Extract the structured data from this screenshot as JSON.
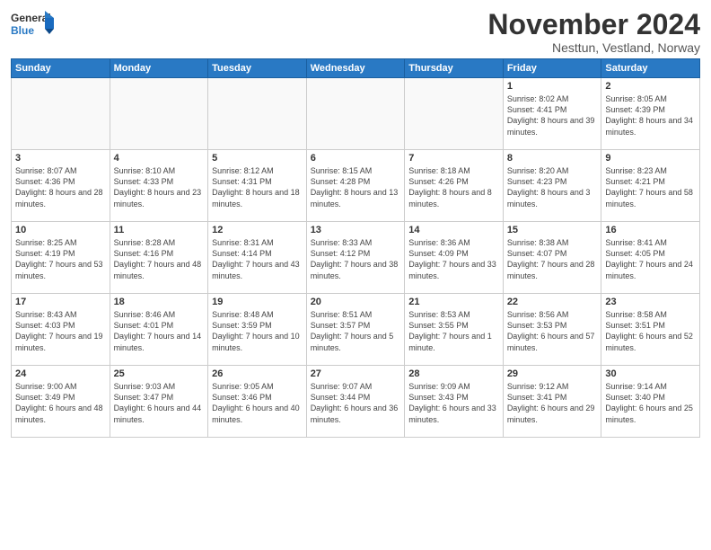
{
  "header": {
    "logo_general": "General",
    "logo_blue": "Blue",
    "month_title": "November 2024",
    "location": "Nesttun, Vestland, Norway"
  },
  "weekdays": [
    "Sunday",
    "Monday",
    "Tuesday",
    "Wednesday",
    "Thursday",
    "Friday",
    "Saturday"
  ],
  "weeks": [
    [
      {
        "day": "",
        "info": ""
      },
      {
        "day": "",
        "info": ""
      },
      {
        "day": "",
        "info": ""
      },
      {
        "day": "",
        "info": ""
      },
      {
        "day": "",
        "info": ""
      },
      {
        "day": "1",
        "info": "Sunrise: 8:02 AM\nSunset: 4:41 PM\nDaylight: 8 hours and 39 minutes."
      },
      {
        "day": "2",
        "info": "Sunrise: 8:05 AM\nSunset: 4:39 PM\nDaylight: 8 hours and 34 minutes."
      }
    ],
    [
      {
        "day": "3",
        "info": "Sunrise: 8:07 AM\nSunset: 4:36 PM\nDaylight: 8 hours and 28 minutes."
      },
      {
        "day": "4",
        "info": "Sunrise: 8:10 AM\nSunset: 4:33 PM\nDaylight: 8 hours and 23 minutes."
      },
      {
        "day": "5",
        "info": "Sunrise: 8:12 AM\nSunset: 4:31 PM\nDaylight: 8 hours and 18 minutes."
      },
      {
        "day": "6",
        "info": "Sunrise: 8:15 AM\nSunset: 4:28 PM\nDaylight: 8 hours and 13 minutes."
      },
      {
        "day": "7",
        "info": "Sunrise: 8:18 AM\nSunset: 4:26 PM\nDaylight: 8 hours and 8 minutes."
      },
      {
        "day": "8",
        "info": "Sunrise: 8:20 AM\nSunset: 4:23 PM\nDaylight: 8 hours and 3 minutes."
      },
      {
        "day": "9",
        "info": "Sunrise: 8:23 AM\nSunset: 4:21 PM\nDaylight: 7 hours and 58 minutes."
      }
    ],
    [
      {
        "day": "10",
        "info": "Sunrise: 8:25 AM\nSunset: 4:19 PM\nDaylight: 7 hours and 53 minutes."
      },
      {
        "day": "11",
        "info": "Sunrise: 8:28 AM\nSunset: 4:16 PM\nDaylight: 7 hours and 48 minutes."
      },
      {
        "day": "12",
        "info": "Sunrise: 8:31 AM\nSunset: 4:14 PM\nDaylight: 7 hours and 43 minutes."
      },
      {
        "day": "13",
        "info": "Sunrise: 8:33 AM\nSunset: 4:12 PM\nDaylight: 7 hours and 38 minutes."
      },
      {
        "day": "14",
        "info": "Sunrise: 8:36 AM\nSunset: 4:09 PM\nDaylight: 7 hours and 33 minutes."
      },
      {
        "day": "15",
        "info": "Sunrise: 8:38 AM\nSunset: 4:07 PM\nDaylight: 7 hours and 28 minutes."
      },
      {
        "day": "16",
        "info": "Sunrise: 8:41 AM\nSunset: 4:05 PM\nDaylight: 7 hours and 24 minutes."
      }
    ],
    [
      {
        "day": "17",
        "info": "Sunrise: 8:43 AM\nSunset: 4:03 PM\nDaylight: 7 hours and 19 minutes."
      },
      {
        "day": "18",
        "info": "Sunrise: 8:46 AM\nSunset: 4:01 PM\nDaylight: 7 hours and 14 minutes."
      },
      {
        "day": "19",
        "info": "Sunrise: 8:48 AM\nSunset: 3:59 PM\nDaylight: 7 hours and 10 minutes."
      },
      {
        "day": "20",
        "info": "Sunrise: 8:51 AM\nSunset: 3:57 PM\nDaylight: 7 hours and 5 minutes."
      },
      {
        "day": "21",
        "info": "Sunrise: 8:53 AM\nSunset: 3:55 PM\nDaylight: 7 hours and 1 minute."
      },
      {
        "day": "22",
        "info": "Sunrise: 8:56 AM\nSunset: 3:53 PM\nDaylight: 6 hours and 57 minutes."
      },
      {
        "day": "23",
        "info": "Sunrise: 8:58 AM\nSunset: 3:51 PM\nDaylight: 6 hours and 52 minutes."
      }
    ],
    [
      {
        "day": "24",
        "info": "Sunrise: 9:00 AM\nSunset: 3:49 PM\nDaylight: 6 hours and 48 minutes."
      },
      {
        "day": "25",
        "info": "Sunrise: 9:03 AM\nSunset: 3:47 PM\nDaylight: 6 hours and 44 minutes."
      },
      {
        "day": "26",
        "info": "Sunrise: 9:05 AM\nSunset: 3:46 PM\nDaylight: 6 hours and 40 minutes."
      },
      {
        "day": "27",
        "info": "Sunrise: 9:07 AM\nSunset: 3:44 PM\nDaylight: 6 hours and 36 minutes."
      },
      {
        "day": "28",
        "info": "Sunrise: 9:09 AM\nSunset: 3:43 PM\nDaylight: 6 hours and 33 minutes."
      },
      {
        "day": "29",
        "info": "Sunrise: 9:12 AM\nSunset: 3:41 PM\nDaylight: 6 hours and 29 minutes."
      },
      {
        "day": "30",
        "info": "Sunrise: 9:14 AM\nSunset: 3:40 PM\nDaylight: 6 hours and 25 minutes."
      }
    ]
  ]
}
